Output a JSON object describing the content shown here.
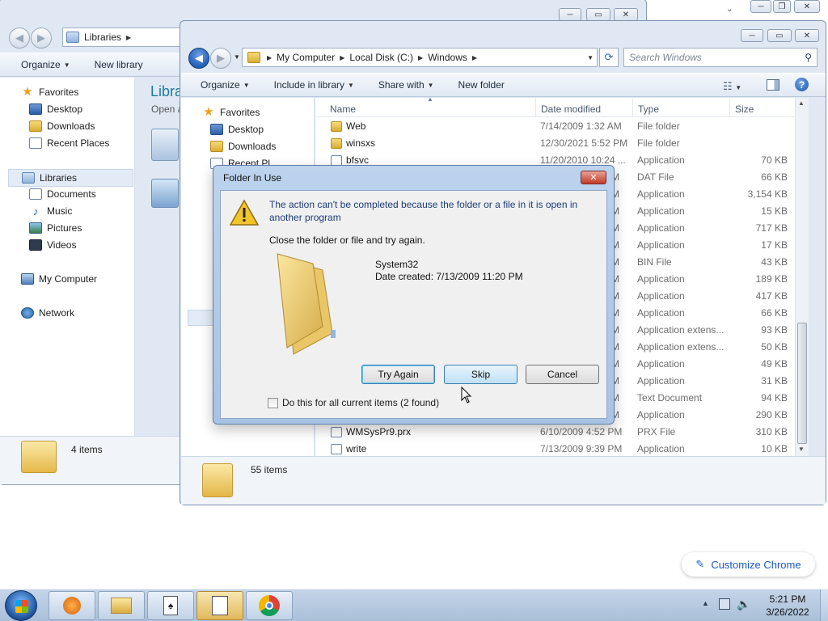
{
  "back_window": {
    "address": [
      "Libraries"
    ],
    "toolbar": {
      "organize": "Organize",
      "new_library": "New library"
    },
    "nav": {
      "favorites": "Favorites",
      "desktop": "Desktop",
      "downloads": "Downloads",
      "recent": "Recent Places",
      "libraries": "Libraries",
      "documents": "Documents",
      "music": "Music",
      "pictures": "Pictures",
      "videos": "Videos",
      "computer": "My Computer",
      "network": "Network"
    },
    "content_title": "Libra",
    "content_sub": "Open a",
    "status": "4 items"
  },
  "front_window": {
    "address": [
      "My Computer",
      "Local Disk (C:)",
      "Windows"
    ],
    "search_placeholder": "Search Windows",
    "toolbar": {
      "organize": "Organize",
      "include": "Include in library",
      "share": "Share with",
      "new_folder": "New folder"
    },
    "nav": {
      "favorites": "Favorites",
      "desktop": "Desktop",
      "downloads": "Downloads",
      "recent": "Recent Pl"
    },
    "columns": {
      "name": "Name",
      "date": "Date modified",
      "type": "Type",
      "size": "Size"
    },
    "rows": [
      {
        "name": "Web",
        "date": "7/14/2009 1:32 AM",
        "type": "File folder",
        "size": ""
      },
      {
        "name": "winsxs",
        "date": "12/30/2021 5:52 PM",
        "type": "File folder",
        "size": ""
      },
      {
        "name": "bfsvc",
        "date": "11/20/2010 10:24 ...",
        "type": "Application",
        "size": "70 KB"
      },
      {
        "name": "",
        "date": "M",
        "type": "DAT File",
        "size": "66 KB"
      },
      {
        "name": "",
        "date": "M",
        "type": "Application",
        "size": "3,154 KB"
      },
      {
        "name": "",
        "date": "M",
        "type": "Application",
        "size": "15 KB"
      },
      {
        "name": "",
        "date": "M",
        "type": "Application",
        "size": "717 KB"
      },
      {
        "name": "",
        "date": "M",
        "type": "Application",
        "size": "17 KB"
      },
      {
        "name": "",
        "date": "M",
        "type": "BIN File",
        "size": "43 KB"
      },
      {
        "name": "",
        "date": "M",
        "type": "Application",
        "size": "189 KB"
      },
      {
        "name": "",
        "date": "M",
        "type": "Application",
        "size": "417 KB"
      },
      {
        "name": "",
        "date": "M",
        "type": "Application",
        "size": "66 KB"
      },
      {
        "name": "",
        "date": "M",
        "type": "Application extens...",
        "size": "93 KB"
      },
      {
        "name": "",
        "date": "M",
        "type": "Application extens...",
        "size": "50 KB"
      },
      {
        "name": "",
        "date": "M",
        "type": "Application",
        "size": "49 KB"
      },
      {
        "name": "",
        "date": "M",
        "type": "Application",
        "size": "31 KB"
      },
      {
        "name": "",
        "date": "M",
        "type": "Text Document",
        "size": "94 KB"
      },
      {
        "name": "",
        "date": "M",
        "type": "Application",
        "size": "290 KB"
      },
      {
        "name": "WMSysPr9.prx",
        "date": "6/10/2009 4:52 PM",
        "type": "PRX File",
        "size": "310 KB"
      },
      {
        "name": "write",
        "date": "7/13/2009 9:39 PM",
        "type": "Application",
        "size": "10 KB"
      }
    ],
    "status": "55 items"
  },
  "dialog": {
    "title": "Folder In Use",
    "message": "The action can't be completed because the folder or a file in it is open in another program",
    "hint": "Close the folder or file and try again.",
    "item_name": "System32",
    "item_date": "Date created: 7/13/2009 11:20 PM",
    "try_again": "Try Again",
    "skip": "Skip",
    "cancel": "Cancel",
    "checkbox": "Do this for all current items (2 found)"
  },
  "chrome_chip": "Customize Chrome",
  "clock": {
    "time": "5:21 PM",
    "date": "3/26/2022"
  }
}
